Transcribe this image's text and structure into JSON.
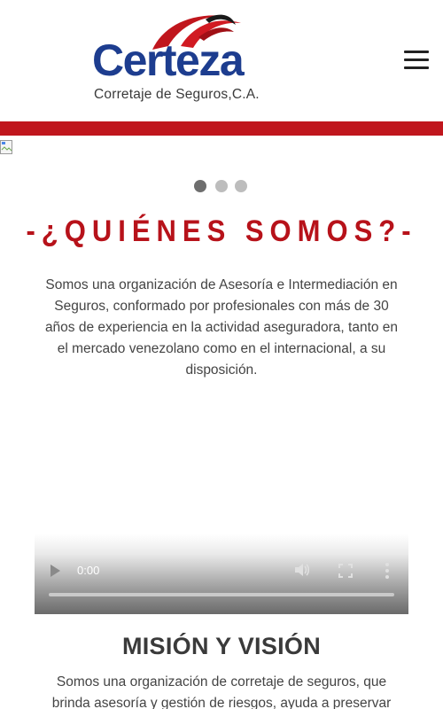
{
  "header": {
    "logo_word": "Certeza",
    "logo_tagline": "Corretaje de Seguros,C.A.",
    "menu_icon": "hamburger-menu-icon"
  },
  "colors": {
    "brand_blue": "#1d3d8f",
    "brand_red": "#c0161d",
    "title_red": "#b7121a",
    "text": "#444444"
  },
  "carousel": {
    "dots": [
      {
        "label": "slide 1",
        "active": true
      },
      {
        "label": "slide 2",
        "active": false
      },
      {
        "label": "slide 3",
        "active": false
      }
    ]
  },
  "about": {
    "title": "-¿QUIÉNES SOMOS?-",
    "text": "Somos una organización de Asesoría e Intermediación en Seguros, conformado por profesionales con más de 30 años de experiencia en la actividad aseguradora, tanto en el mercado venezolano como en el internacional, a su disposición."
  },
  "video": {
    "time": "0:00",
    "icons": [
      "play-icon",
      "volume-icon",
      "fullscreen-icon",
      "more-options-icon"
    ]
  },
  "mission": {
    "title": "MISIÓN Y VISIÓN",
    "text": "Somos una organización de corretaje de seguros, que brinda asesoría y gestión de riesgos, ayuda a preservar"
  }
}
